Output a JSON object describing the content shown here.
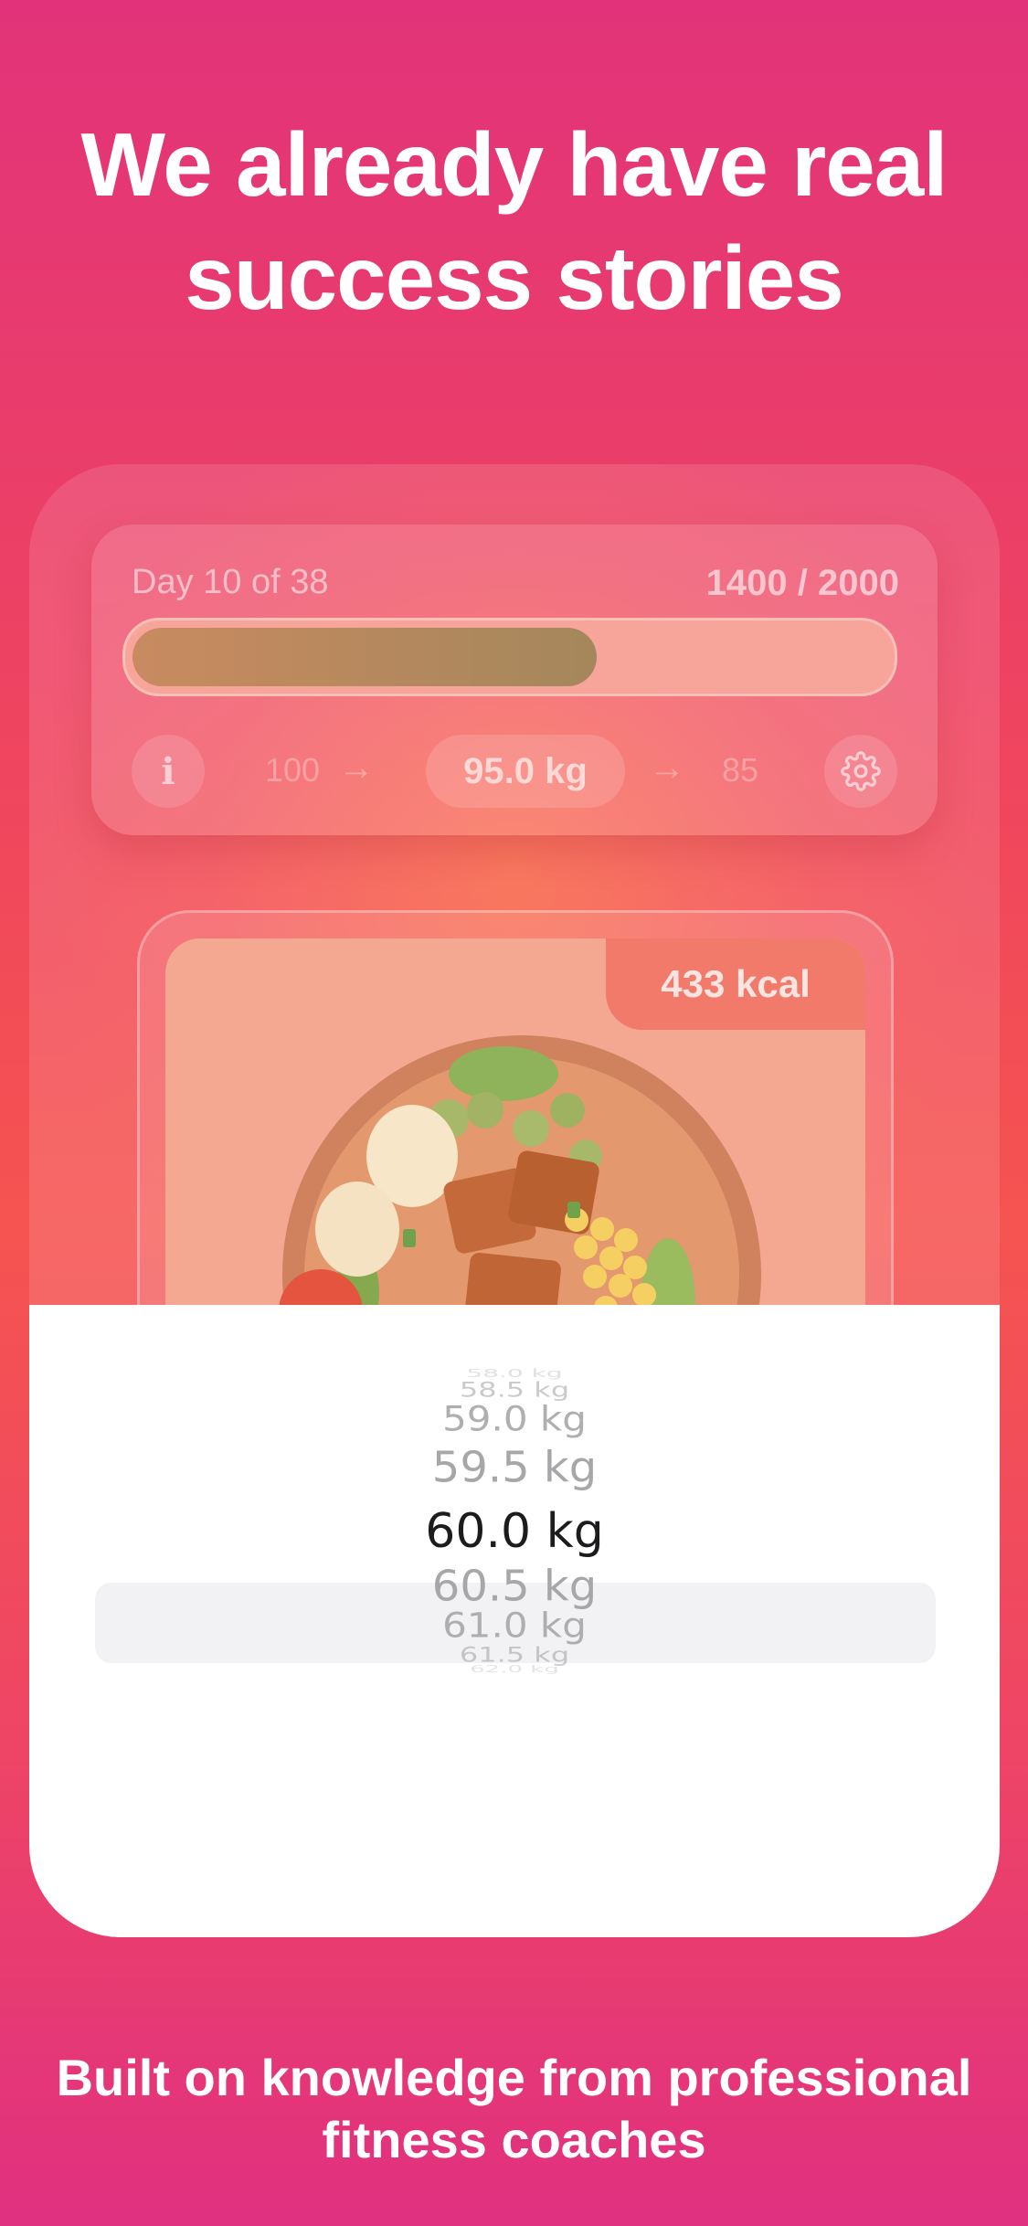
{
  "headline": "We already have real success stories",
  "progress_card": {
    "day_label": "Day 10 of 38",
    "calories_label": "1400 / 2000",
    "calories_progress_fraction": 0.62,
    "start_weight": "100",
    "current_weight": "95.0 kg",
    "goal_weight": "85",
    "arrow": "→",
    "info_icon_glyph": "i"
  },
  "meal_card": {
    "kcal": "433 kcal"
  },
  "weight_picker": {
    "items": [
      "58.0 kg",
      "58.5 kg",
      "59.0 kg",
      "59.5 kg",
      "60.0 kg",
      "60.5 kg",
      "61.0 kg",
      "61.5 kg",
      "62.0 kg"
    ],
    "selected": "60.0 kg"
  },
  "footer": "Built on knowledge from professional fitness coaches",
  "colors": {
    "background_top": "#e2337a",
    "background_mid": "#f55450",
    "progress_fill": "#a5875c",
    "kcal_badge": "#f27a6a",
    "picker_selected_text": "#1c1c1e",
    "picker_text": "#a7a7a9"
  }
}
